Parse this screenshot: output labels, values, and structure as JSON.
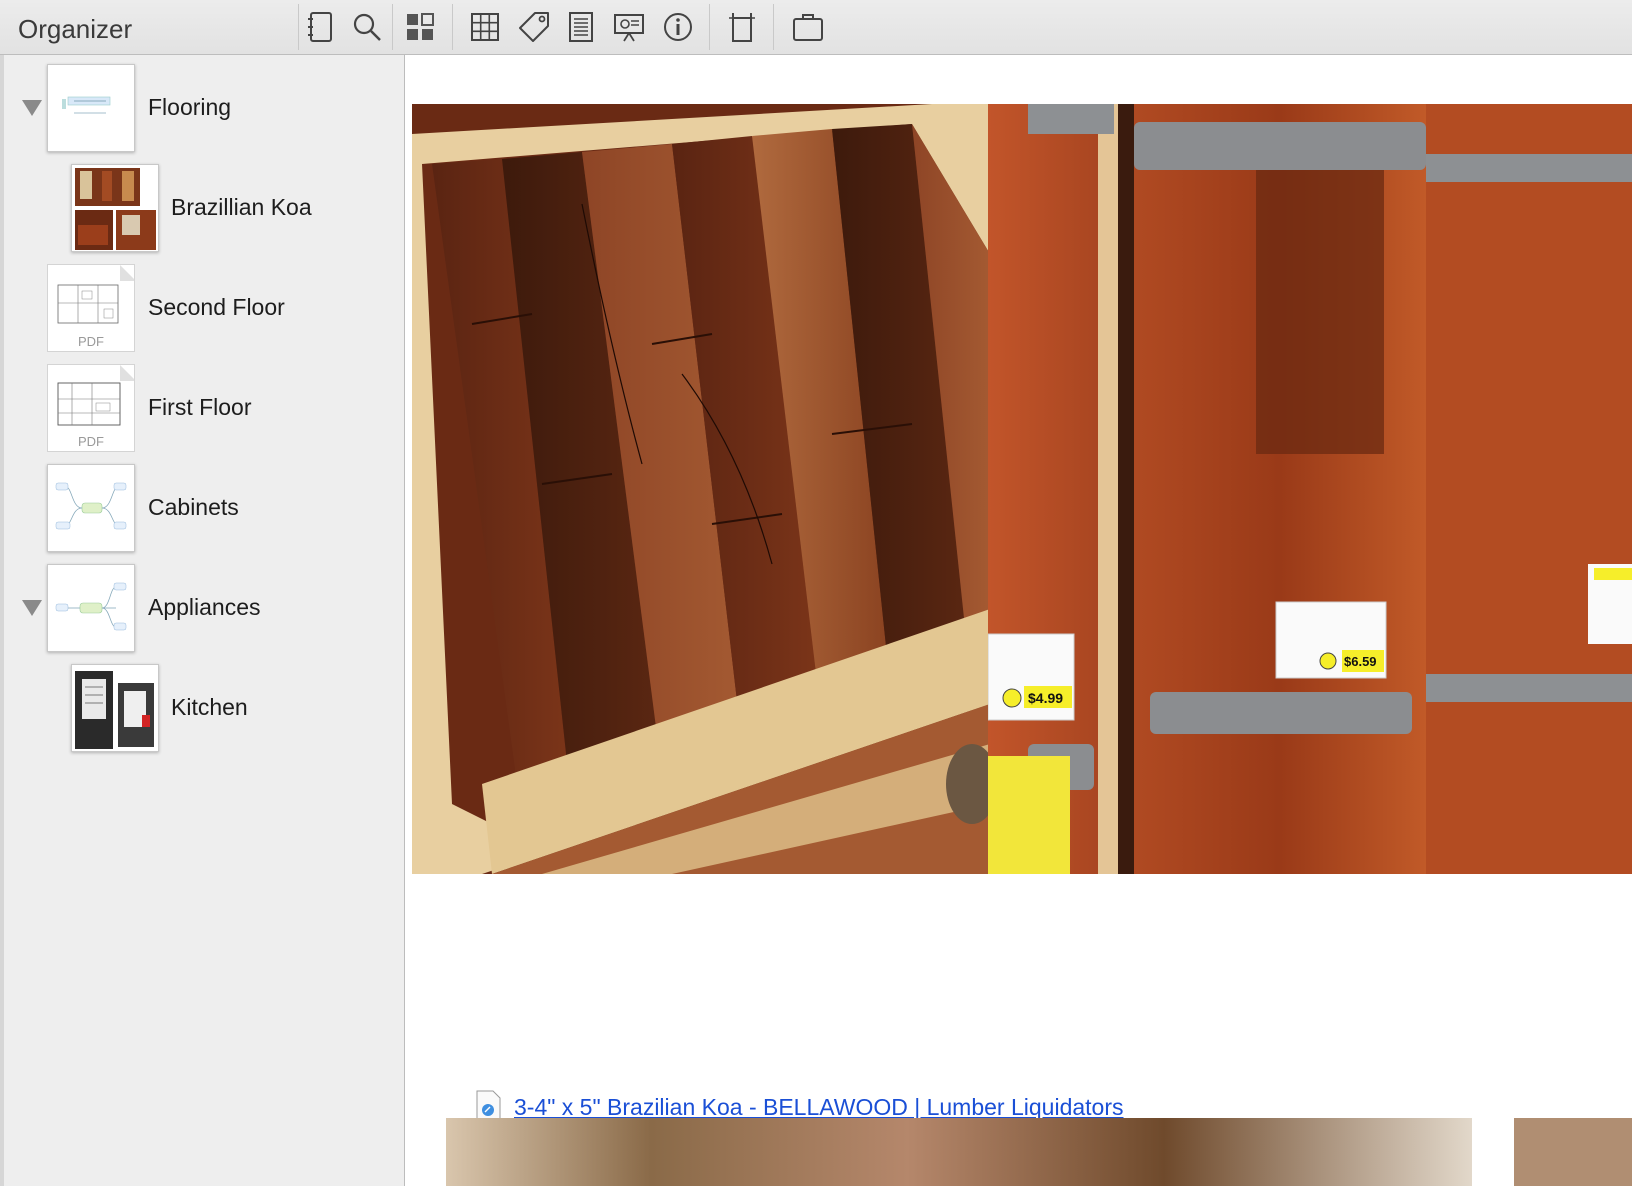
{
  "toolbar": {
    "organizer_title": "Organizer",
    "buttons": [
      {
        "name": "notebook-icon"
      },
      {
        "name": "search-icon"
      },
      {
        "name": "thumbnails-icon"
      },
      {
        "name": "grid-icon"
      },
      {
        "name": "tag-icon"
      },
      {
        "name": "notes-icon"
      },
      {
        "name": "presentation-icon"
      },
      {
        "name": "info-icon"
      },
      {
        "name": "columns-icon"
      },
      {
        "name": "briefcase-icon"
      }
    ]
  },
  "sidebar": {
    "items": [
      {
        "label": "Flooring",
        "expanded": true,
        "thumb": "mindmap"
      },
      {
        "label": "Brazillian Koa",
        "thumb": "photos"
      },
      {
        "label": "Second Floor",
        "thumb": "pdf",
        "badge": "PDF"
      },
      {
        "label": "First Floor",
        "thumb": "pdf",
        "badge": "PDF"
      },
      {
        "label": "Cabinets",
        "thumb": "mindmap"
      },
      {
        "label": "Appliances",
        "expanded": true,
        "thumb": "mindmap"
      },
      {
        "label": "Kitchen",
        "thumb": "photos"
      }
    ]
  },
  "content": {
    "link_text": "3-4\" x 5\" Brazilian Koa - BELLAWOOD | Lumber Liquidators",
    "price_tags": [
      "$4.99",
      "$6.59"
    ]
  },
  "colors": {
    "link": "#1a4fd6",
    "sidebar_bg": "#eeeeee",
    "toolbar_bg": "#e6e6e6",
    "wood_dark": "#5a2a14",
    "wood_mid": "#8b3e1e",
    "wood_light": "#e8cfa0",
    "price_yellow": "#f6ee2a"
  }
}
